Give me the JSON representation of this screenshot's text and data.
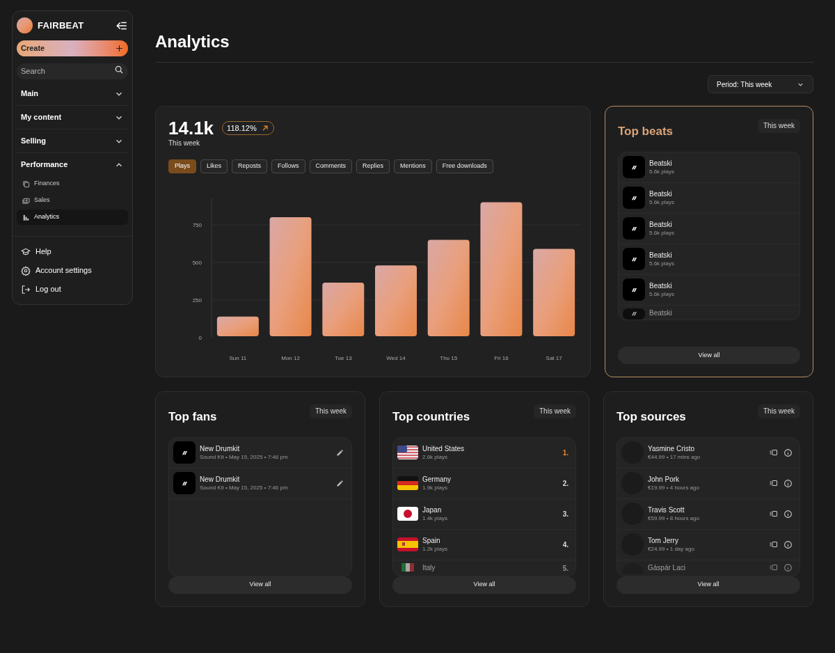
{
  "sidebar": {
    "brand": "FAIRBEAT",
    "create_button": "Create",
    "search": {
      "placeholder": "Search"
    },
    "sections": [
      {
        "label": "Main",
        "expanded": false
      },
      {
        "label": "My content",
        "expanded": false
      },
      {
        "label": "Selling",
        "expanded": false
      },
      {
        "label": "Performance",
        "expanded": true,
        "children": [
          {
            "label": "Finances",
            "selected": false
          },
          {
            "label": "Sales",
            "selected": false
          },
          {
            "label": "Analytics",
            "selected": true
          }
        ]
      }
    ],
    "footer_items": [
      {
        "label": "Help"
      },
      {
        "label": "Account settings"
      },
      {
        "label": "Log out"
      }
    ]
  },
  "page_title": "Analytics",
  "period_dropdown": "Period: This week",
  "overview": {
    "total": "14.1k",
    "subtitle": "This week",
    "change": "118.12%",
    "tabs": [
      {
        "label": "Plays",
        "selected": true
      },
      {
        "label": "Likes",
        "selected": false
      },
      {
        "label": "Reposts",
        "selected": false
      },
      {
        "label": "Follows",
        "selected": false
      },
      {
        "label": "Comments",
        "selected": false
      },
      {
        "label": "Replies",
        "selected": false
      },
      {
        "label": "Mentions",
        "selected": false
      },
      {
        "label": "Free downloads",
        "selected": false
      }
    ],
    "chart_data": {
      "type": "bar",
      "categories": [
        "Sun 11",
        "Mon 12",
        "Tue 13",
        "Wed 14",
        "Thu 15",
        "Fri 16",
        "Sat 17"
      ],
      "series": [
        {
          "color": "#e8874a",
          "values": [
            140,
            800,
            365,
            480,
            650,
            900,
            590
          ]
        }
      ],
      "grid": true,
      "ylim": [
        0,
        925
      ],
      "yticks": [
        0,
        250,
        500,
        750
      ]
    }
  },
  "top_beats": {
    "title": "Top beats",
    "period": "This week",
    "highlighted": true,
    "button": "View all",
    "rows": [
      {
        "name": "Beatski",
        "detail": "5.6k plays"
      },
      {
        "name": "Beatski",
        "detail": "5.6k plays"
      },
      {
        "name": "Beatski",
        "detail": "5.6k plays"
      },
      {
        "name": "Beatski",
        "detail": "5.6k plays"
      },
      {
        "name": "Beatski",
        "detail": "5.6k plays"
      },
      {
        "name": "Beatski"
      }
    ]
  },
  "top_fans": {
    "title": "Top fans",
    "period": "This week",
    "highlighted": false,
    "button": "View all",
    "rows": [
      {
        "name": "New Drumkit",
        "detail": "Sound Kit • May 15, 2025 • 7:46 pm"
      },
      {
        "name": "New Drumkit",
        "detail": "Sound Kit • May 15, 2025 • 7:46 pm"
      }
    ]
  },
  "top_countries": {
    "title": "Top countries",
    "period": "This week",
    "highlighted": false,
    "button": "View all",
    "rows": [
      {
        "kind": "us",
        "name": "United States",
        "detail": "2.6k plays",
        "rank": "1.",
        "top": true
      },
      {
        "kind": "de",
        "name": "Germany",
        "detail": "1.9k plays",
        "rank": "2.",
        "top": false
      },
      {
        "kind": "jp",
        "name": "Japan",
        "detail": "1.4k plays",
        "rank": "3.",
        "top": false
      },
      {
        "kind": "es",
        "name": "Spain",
        "detail": "1.2k plays",
        "rank": "4.",
        "top": false
      },
      {
        "kind": "it",
        "name": "Italy",
        "rank": "5.",
        "top": false
      }
    ]
  },
  "top_sources": {
    "title": "Top sources",
    "period": "This week",
    "highlighted": false,
    "button": "View all",
    "rows": [
      {
        "name": "Yasmine Cristo",
        "detail": "€44.99 • 17 mins ago"
      },
      {
        "name": "John Pork",
        "detail": "€19.99 • 4 hours ago"
      },
      {
        "name": "Travis Scott",
        "detail": "€59.99 • 8 hours ago"
      },
      {
        "name": "Tom Jerry",
        "detail": "€24.99 • 1 day ago"
      },
      {
        "name": "Gáspár Laci"
      }
    ]
  }
}
